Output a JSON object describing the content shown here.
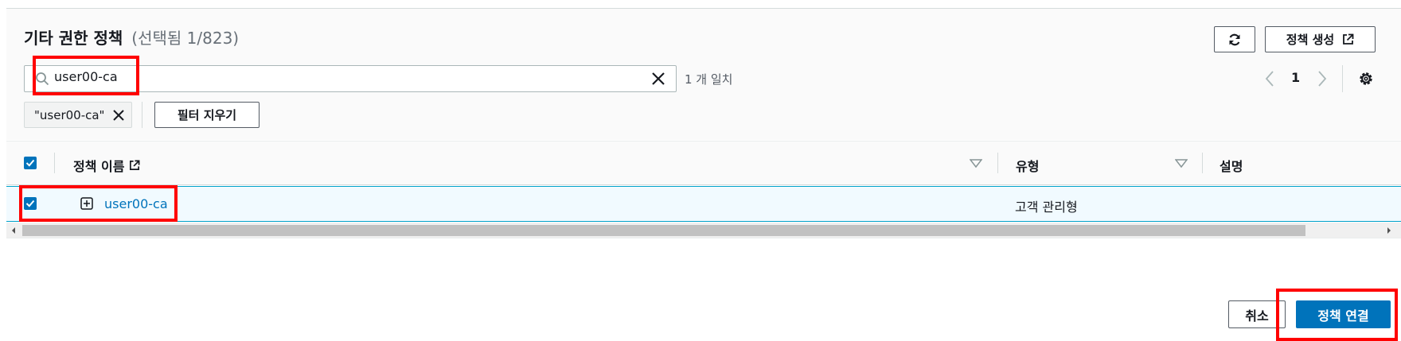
{
  "section": {
    "title": "기타 권한 정책",
    "subtitle": "(선택됨 1/823)"
  },
  "toolbar": {
    "refresh_icon": "refresh-icon",
    "create_label": "정책 생성",
    "create_icon": "external-link-icon"
  },
  "search": {
    "value": "user00-ca",
    "icon": "search-icon",
    "clear_icon": "close-icon",
    "match_count": "1 개 일치"
  },
  "pagination": {
    "current_page": "1"
  },
  "filter": {
    "token_label": "\"user00-ca\"",
    "clear_label": "필터 지우기"
  },
  "table": {
    "columns": [
      {
        "label": "정책 이름"
      },
      {
        "label": "유형"
      },
      {
        "label": "설명"
      }
    ],
    "rows": [
      {
        "selected": true,
        "name": "user00-ca",
        "type": "고객 관리형",
        "description": ""
      }
    ]
  },
  "footer": {
    "cancel_label": "취소",
    "attach_label": "정책 연결"
  },
  "colors": {
    "primary": "#0073bb",
    "highlight": "#ff0000",
    "selected_row_bg": "#f1faff"
  }
}
